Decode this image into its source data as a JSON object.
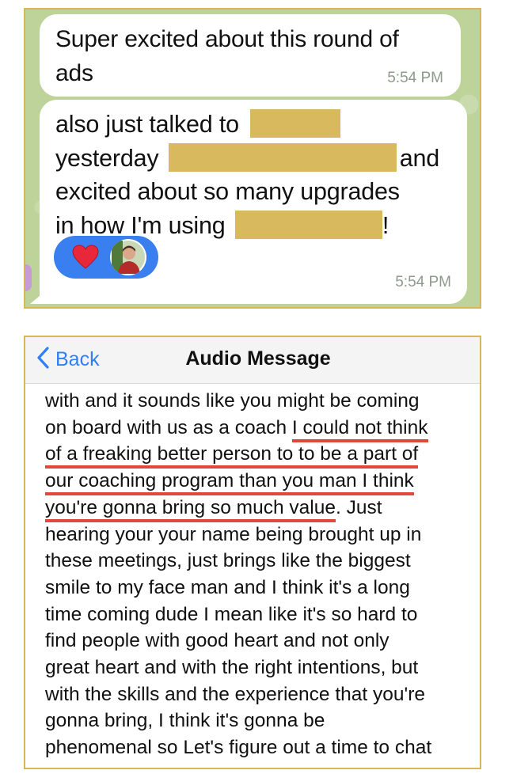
{
  "chat": {
    "message1": {
      "line1": "Super excited about this round of",
      "line2": "ads",
      "time": "5:54 PM"
    },
    "message2": {
      "line1_a": "also just talked to",
      "line2_a": "yesterday",
      "line2_b": "and",
      "line3": "excited about so many upgrades",
      "line4_a": "in how I'm using",
      "line4_b": "!",
      "time": "5:54 PM",
      "reactions": [
        "heart-icon",
        "avatar"
      ]
    },
    "colors": {
      "background": "#bdd39a",
      "bubble": "#ffffff",
      "redaction": "#d8b95e",
      "reaction_pill": "#3a7ff0"
    }
  },
  "audio": {
    "back_label": "Back",
    "title": "Audio Message",
    "lines": [
      "with and it sounds like you might be coming",
      "on board with us as a coach ",
      "I could not think",
      "of a freaking better person to to be a part of",
      "our coaching program than you man I think",
      "you're gonna bring so much value",
      ". Just",
      "hearing your your name being brought up in",
      "these meetings, just brings like the biggest",
      "smile to my face man and I think it's a long",
      "time coming dude I mean like it's so hard to",
      "find people with good heart and not only",
      "great heart and with the right intentions, but",
      "with the skills and the experience that you're",
      "gonna bring, I think it's gonna be",
      "phenomenal so Let's figure out a time to chat"
    ],
    "colors": {
      "link": "#2f7ff6",
      "underline": "#e0473d"
    }
  }
}
